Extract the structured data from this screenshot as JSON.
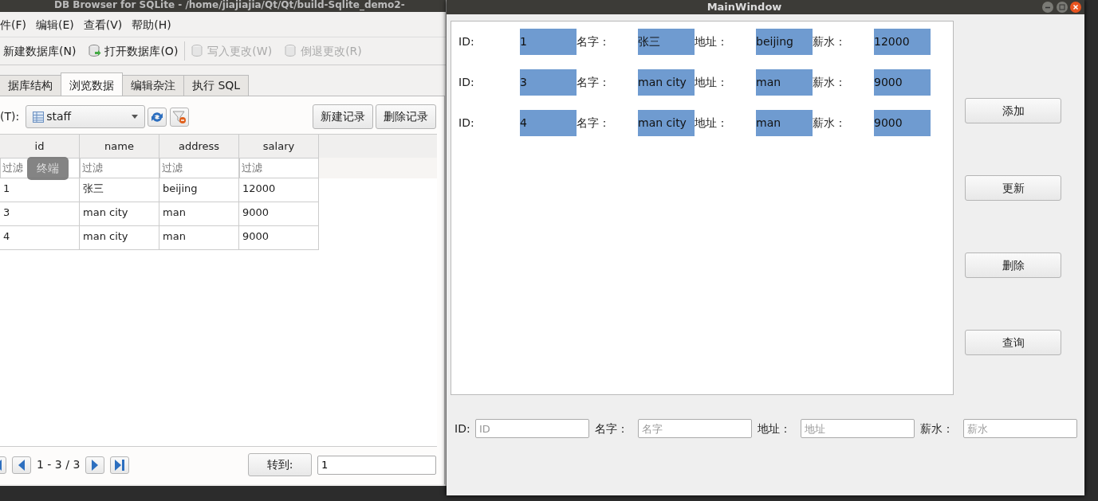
{
  "db_window": {
    "title": "DB Browser for SQLite - /home/jiajiajia/Qt/Qt/build-Sqlite_demo2-",
    "menu": [
      "件(F)",
      "编辑(E)",
      "查看(V)",
      "帮助(H)"
    ],
    "toolbar": [
      {
        "label": "新建数据库(N)",
        "disabled": false,
        "icon": false
      },
      {
        "label": "打开数据库(O)",
        "disabled": false,
        "icon": true
      },
      {
        "label": "写入更改(W)",
        "disabled": true,
        "icon": true
      },
      {
        "label": "倒退更改(R)",
        "disabled": true,
        "icon": true
      }
    ],
    "tabs": [
      {
        "label": "据库结构",
        "selected": false
      },
      {
        "label": "浏览数据",
        "selected": true
      },
      {
        "label": "编辑杂注",
        "selected": false
      },
      {
        "label": "执行 SQL",
        "selected": false
      }
    ],
    "table_label": "(T):",
    "table_select": "staff",
    "buttons": [
      "新建记录",
      "删除记录"
    ],
    "columns": [
      "id",
      "name",
      "address",
      "salary"
    ],
    "filters": [
      "过滤",
      "过滤",
      "过滤",
      "过滤"
    ],
    "rows": [
      [
        "1",
        "张三",
        "beijing",
        "12000"
      ],
      [
        "3",
        "man city",
        "man",
        "9000"
      ],
      [
        "4",
        "man city",
        "man",
        "9000"
      ]
    ],
    "page_info": "1 - 3 / 3",
    "goto_button": "转到:",
    "goto_value": "1"
  },
  "tooltip": "终端",
  "main_window": {
    "title": "MainWindow",
    "records": [
      {
        "fields": [
          {
            "label": "ID:",
            "value": "1"
          },
          {
            "label": "名字：",
            "value": "张三"
          },
          {
            "label": "地址：",
            "value": "beijing"
          },
          {
            "label": "薪水：",
            "value": "12000"
          }
        ]
      },
      {
        "fields": [
          {
            "label": "ID:",
            "value": "3"
          },
          {
            "label": "名字：",
            "value": "man city"
          },
          {
            "label": "地址：",
            "value": "man"
          },
          {
            "label": "薪水：",
            "value": "9000"
          }
        ]
      },
      {
        "fields": [
          {
            "label": "ID:",
            "value": "4"
          },
          {
            "label": "名字：",
            "value": "man city"
          },
          {
            "label": "地址：",
            "value": "man"
          },
          {
            "label": "薪水：",
            "value": "9000"
          }
        ]
      }
    ],
    "buttons": [
      "添加",
      "更新",
      "删除",
      "查询"
    ],
    "form": [
      {
        "label": "ID:",
        "placeholder": "ID"
      },
      {
        "label": "名字：",
        "placeholder": "名字"
      },
      {
        "label": "地址：",
        "placeholder": "地址"
      },
      {
        "label": "薪水：",
        "placeholder": "薪水"
      }
    ]
  }
}
